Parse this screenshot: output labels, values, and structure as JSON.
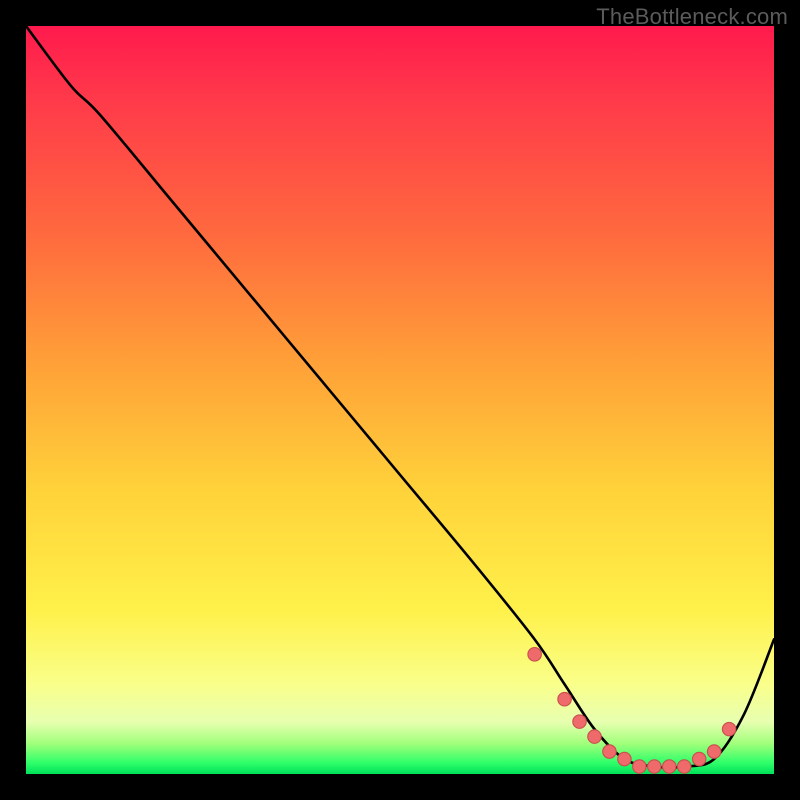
{
  "watermark": "TheBottleneck.com",
  "colors": {
    "curve_stroke": "#000000",
    "marker_fill": "#ef6a6a",
    "marker_stroke": "#c94f4f",
    "frame_bg": "#000000"
  },
  "chart_data": {
    "type": "line",
    "title": "",
    "xlabel": "",
    "ylabel": "",
    "xlim": [
      0,
      100
    ],
    "ylim": [
      0,
      100
    ],
    "grid": false,
    "legend": false,
    "note": "Values are estimated from the rendered pixels; no axis ticks are shown.",
    "series": [
      {
        "name": "bottleneck-curve",
        "x": [
          0,
          6,
          10,
          20,
          30,
          40,
          50,
          60,
          68,
          72,
          76,
          80,
          84,
          88,
          92,
          96,
          100
        ],
        "y": [
          100,
          92,
          88,
          76,
          64,
          52,
          40,
          28,
          18,
          12,
          6,
          2,
          1,
          1,
          2,
          8,
          18
        ]
      }
    ],
    "markers": {
      "name": "highlighted-points",
      "x": [
        68,
        72,
        74,
        76,
        78,
        80,
        82,
        84,
        86,
        88,
        90,
        92,
        94
      ],
      "y": [
        16,
        10,
        7,
        5,
        3,
        2,
        1,
        1,
        1,
        1,
        2,
        3,
        6
      ]
    }
  }
}
